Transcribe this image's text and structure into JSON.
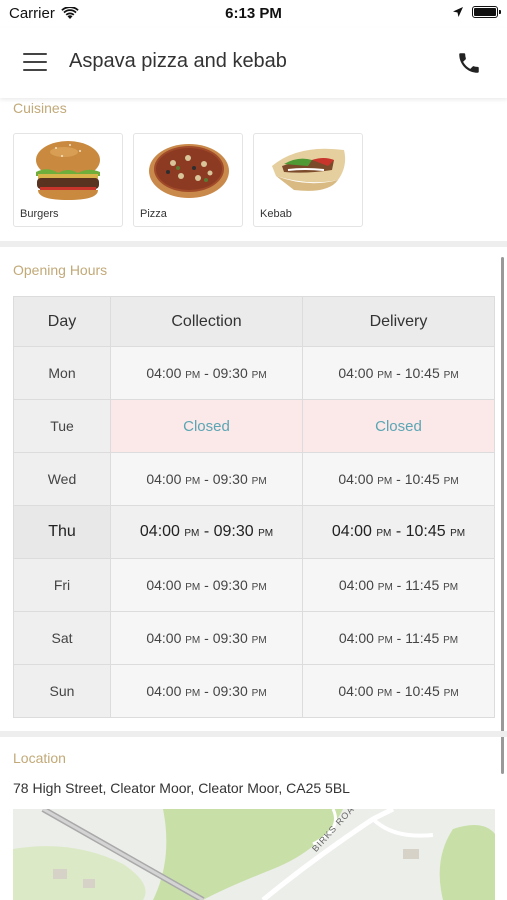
{
  "status_bar": {
    "carrier": "Carrier",
    "time": "6:13 PM"
  },
  "header": {
    "title": "Aspava pizza and kebab"
  },
  "cuisines": {
    "label": "Cuisines",
    "items": [
      {
        "label": "Burgers",
        "icon": "burger-image"
      },
      {
        "label": "Pizza",
        "icon": "pizza-image"
      },
      {
        "label": "Kebab",
        "icon": "kebab-image"
      }
    ]
  },
  "opening_hours": {
    "label": "Opening Hours",
    "columns": [
      "Day",
      "Collection",
      "Delivery"
    ],
    "rows": [
      {
        "day": "Mon",
        "collection": {
          "from": "04:00",
          "from_ampm": "PM",
          "to": "09:30",
          "to_ampm": "PM"
        },
        "delivery": {
          "from": "04:00",
          "from_ampm": "PM",
          "to": "10:45",
          "to_ampm": "PM"
        }
      },
      {
        "day": "Tue",
        "collection_closed": "Closed",
        "delivery_closed": "Closed"
      },
      {
        "day": "Wed",
        "collection": {
          "from": "04:00",
          "from_ampm": "PM",
          "to": "09:30",
          "to_ampm": "PM"
        },
        "delivery": {
          "from": "04:00",
          "from_ampm": "PM",
          "to": "10:45",
          "to_ampm": "PM"
        }
      },
      {
        "day": "Thu",
        "collection": {
          "from": "04:00",
          "from_ampm": "PM",
          "to": "09:30",
          "to_ampm": "PM"
        },
        "delivery": {
          "from": "04:00",
          "from_ampm": "PM",
          "to": "10:45",
          "to_ampm": "PM"
        }
      },
      {
        "day": "Fri",
        "collection": {
          "from": "04:00",
          "from_ampm": "PM",
          "to": "09:30",
          "to_ampm": "PM"
        },
        "delivery": {
          "from": "04:00",
          "from_ampm": "PM",
          "to": "11:45",
          "to_ampm": "PM"
        }
      },
      {
        "day": "Sat",
        "collection": {
          "from": "04:00",
          "from_ampm": "PM",
          "to": "09:30",
          "to_ampm": "PM"
        },
        "delivery": {
          "from": "04:00",
          "from_ampm": "PM",
          "to": "11:45",
          "to_ampm": "PM"
        }
      },
      {
        "day": "Sun",
        "collection": {
          "from": "04:00",
          "from_ampm": "PM",
          "to": "09:30",
          "to_ampm": "PM"
        },
        "delivery": {
          "from": "04:00",
          "from_ampm": "PM",
          "to": "10:45",
          "to_ampm": "PM"
        }
      }
    ]
  },
  "location": {
    "label": "Location",
    "address": "78 High Street, Cleator Moor, Cleator Moor, CA25 5BL",
    "map_road_label": "BIRKS ROAD"
  },
  "colors": {
    "section_label": "#c2a978",
    "closed_text": "#5aa6b4",
    "closed_bg": "#fbe8e8"
  }
}
